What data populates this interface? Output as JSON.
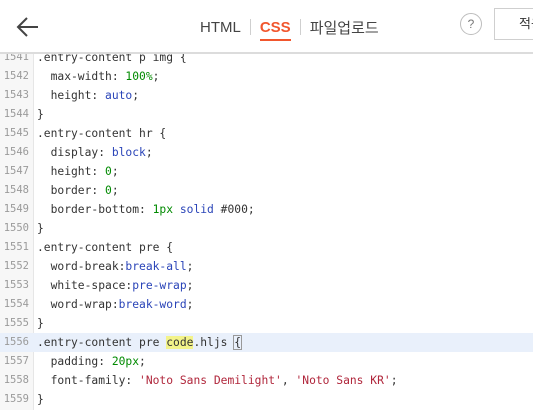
{
  "header": {
    "back_icon": "arrow-left-icon",
    "tabs": [
      {
        "label": "HTML",
        "active": false
      },
      {
        "label": "CSS",
        "active": true
      },
      {
        "label": "파일업로드",
        "active": false
      }
    ],
    "help_label": "?",
    "apply_label": "적용"
  },
  "colors": {
    "accent": "#f1562d",
    "string": "#b0263b",
    "number": "#008a00",
    "keyword": "#2a44b8"
  },
  "editor": {
    "lines": [
      {
        "n": "1541",
        "tokens": [
          {
            "t": ".entry-content p img {",
            "c": "sel"
          }
        ]
      },
      {
        "n": "1542",
        "tokens": [
          {
            "t": "  max-width: ",
            "c": "prop"
          },
          {
            "t": "100%",
            "c": "num"
          },
          {
            "t": ";",
            "c": "prop"
          }
        ]
      },
      {
        "n": "1543",
        "tokens": [
          {
            "t": "  height: ",
            "c": "prop"
          },
          {
            "t": "auto",
            "c": "kw"
          },
          {
            "t": ";",
            "c": "prop"
          }
        ]
      },
      {
        "n": "1544",
        "tokens": [
          {
            "t": "}",
            "c": "sel"
          }
        ]
      },
      {
        "n": "1545",
        "tokens": [
          {
            "t": ".entry-content hr {",
            "c": "sel"
          }
        ]
      },
      {
        "n": "1546",
        "tokens": [
          {
            "t": "  display: ",
            "c": "prop"
          },
          {
            "t": "block",
            "c": "kw"
          },
          {
            "t": ";",
            "c": "prop"
          }
        ]
      },
      {
        "n": "1547",
        "tokens": [
          {
            "t": "  height: ",
            "c": "prop"
          },
          {
            "t": "0",
            "c": "num"
          },
          {
            "t": ";",
            "c": "prop"
          }
        ]
      },
      {
        "n": "1548",
        "tokens": [
          {
            "t": "  border: ",
            "c": "prop"
          },
          {
            "t": "0",
            "c": "num"
          },
          {
            "t": ";",
            "c": "prop"
          }
        ]
      },
      {
        "n": "1549",
        "tokens": [
          {
            "t": "  border-bottom: ",
            "c": "prop"
          },
          {
            "t": "1px",
            "c": "num"
          },
          {
            "t": " ",
            "c": "prop"
          },
          {
            "t": "solid",
            "c": "kw"
          },
          {
            "t": " #000;",
            "c": "prop"
          }
        ]
      },
      {
        "n": "1550",
        "tokens": [
          {
            "t": "}",
            "c": "sel"
          }
        ]
      },
      {
        "n": "1551",
        "tokens": [
          {
            "t": ".entry-content pre {",
            "c": "sel"
          }
        ]
      },
      {
        "n": "1552",
        "tokens": [
          {
            "t": "  word-break:",
            "c": "prop"
          },
          {
            "t": "break-all",
            "c": "kw"
          },
          {
            "t": ";",
            "c": "prop"
          }
        ]
      },
      {
        "n": "1553",
        "tokens": [
          {
            "t": "  white-space:",
            "c": "prop"
          },
          {
            "t": "pre-wrap",
            "c": "kw"
          },
          {
            "t": ";",
            "c": "prop"
          }
        ]
      },
      {
        "n": "1554",
        "tokens": [
          {
            "t": "  word-wrap:",
            "c": "prop"
          },
          {
            "t": "break-word",
            "c": "kw"
          },
          {
            "t": ";",
            "c": "prop"
          }
        ]
      },
      {
        "n": "1555",
        "tokens": [
          {
            "t": "}",
            "c": "sel"
          }
        ]
      },
      {
        "n": "1556",
        "active": true,
        "tokens": [
          {
            "t": ".entry-content pre ",
            "c": "sel"
          },
          {
            "t": "code",
            "c": "sel hl"
          },
          {
            "t": ".hljs ",
            "c": "sel"
          },
          {
            "t": "{",
            "c": "sel bracket-box"
          }
        ]
      },
      {
        "n": "1557",
        "tokens": [
          {
            "t": "  padding: ",
            "c": "prop"
          },
          {
            "t": "20px",
            "c": "num"
          },
          {
            "t": ";",
            "c": "prop"
          }
        ]
      },
      {
        "n": "1558",
        "tokens": [
          {
            "t": "  font-family: ",
            "c": "prop"
          },
          {
            "t": "'Noto Sans Demilight'",
            "c": "str"
          },
          {
            "t": ", ",
            "c": "prop"
          },
          {
            "t": "'Noto Sans KR'",
            "c": "str"
          },
          {
            "t": ";",
            "c": "prop"
          }
        ]
      },
      {
        "n": "1559",
        "tokens": [
          {
            "t": "}",
            "c": "sel"
          }
        ]
      }
    ]
  }
}
